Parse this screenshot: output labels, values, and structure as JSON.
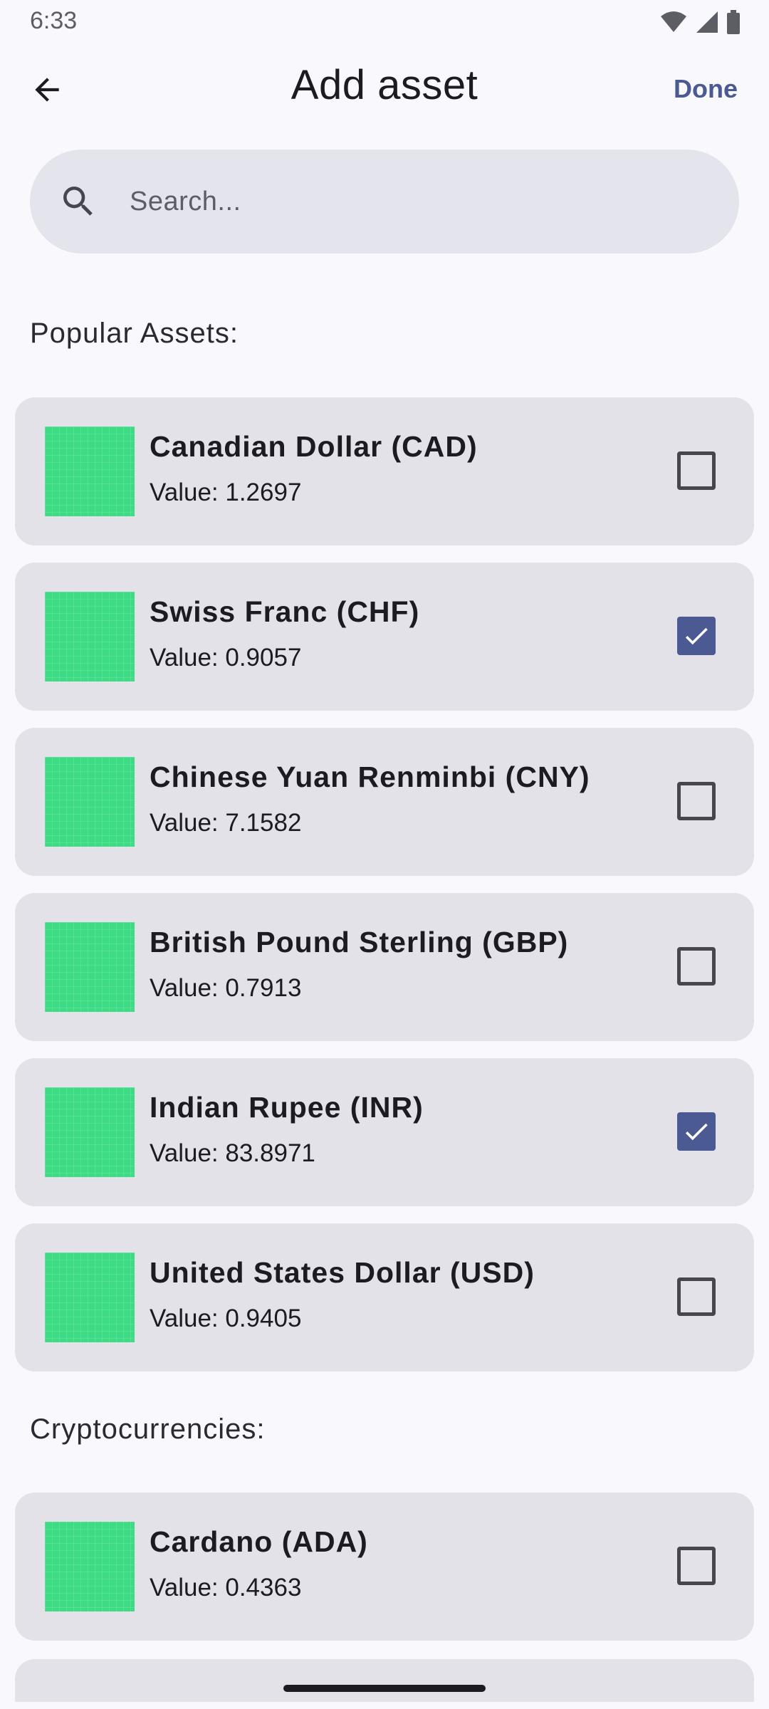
{
  "status_bar": {
    "time": "6:33"
  },
  "app_bar": {
    "title": "Add asset",
    "done_label": "Done"
  },
  "search": {
    "placeholder": "Search..."
  },
  "sections": {
    "popular": "Popular Assets:",
    "crypto": "Cryptocurrencies:"
  },
  "popular_assets": [
    {
      "name": "Canadian Dollar (CAD)",
      "value": "Value: 1.2697",
      "checked": false
    },
    {
      "name": "Swiss Franc (CHF)",
      "value": "Value: 0.9057",
      "checked": true
    },
    {
      "name": "Chinese Yuan Renminbi (CNY)",
      "value": "Value: 7.1582",
      "checked": false
    },
    {
      "name": "British Pound Sterling (GBP)",
      "value": "Value: 0.7913",
      "checked": false
    },
    {
      "name": "Indian Rupee (INR)",
      "value": "Value: 83.8971",
      "checked": true
    },
    {
      "name": "United States Dollar (USD)",
      "value": "Value: 0.9405",
      "checked": false
    }
  ],
  "crypto_assets": [
    {
      "name": "Cardano (ADA)",
      "value": "Value: 0.4363",
      "checked": false
    }
  ],
  "colors": {
    "accent": "#4b5a92",
    "thumbnail": "#3ddc84",
    "card_bg": "#e3e2e8",
    "page_bg": "#f8f8fd"
  },
  "icons": {
    "back": "arrow-back-icon",
    "search": "search-icon",
    "check": "check-icon",
    "wifi": "wifi-icon",
    "signal": "signal-icon",
    "battery": "battery-icon"
  }
}
